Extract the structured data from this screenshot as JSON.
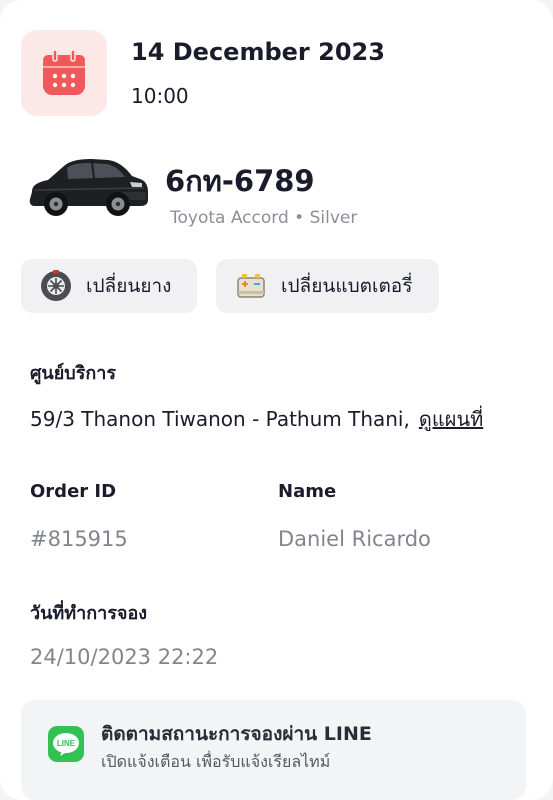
{
  "appointment": {
    "date": "14 December 2023",
    "time": "10:00"
  },
  "vehicle": {
    "plate": "6กท-6789",
    "description": "Toyota Accord • Silver"
  },
  "services": [
    {
      "label": "เปลี่ยนยาง",
      "icon": "tire-icon"
    },
    {
      "label": "เปลี่ยนแบตเตอรี่",
      "icon": "battery-icon"
    }
  ],
  "service_center": {
    "label": "ศูนย์บริการ",
    "address": "59/3 Thanon Tiwanon - Pathum Thani,",
    "map_link": "ดูแผนที่"
  },
  "order": {
    "id_label": "Order ID",
    "id_value": "#815915",
    "name_label": "Name",
    "name_value": "Daniel Ricardo"
  },
  "booking": {
    "label": "วันที่ทำการจอง",
    "value": "24/10/2023 22:22"
  },
  "line_banner": {
    "logo_text": "LINE",
    "title": "ติดตามสถานะการจองผ่าน LINE",
    "subtitle": "เปิดแจ้งเตือน เพื่อรับแจ้งเรียลไทม์"
  },
  "colors": {
    "calendar_accent": "#f0585a",
    "calendar_bg": "#fde8e8",
    "line_green": "#33c154",
    "muted_text": "#82858d"
  }
}
